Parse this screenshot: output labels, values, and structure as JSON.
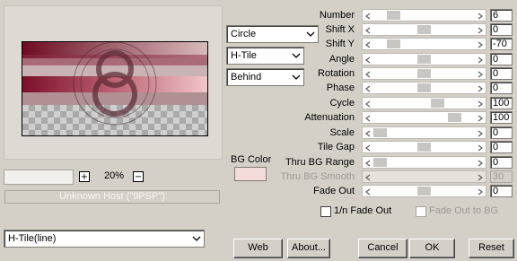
{
  "preview": {
    "zoom_minus": "−",
    "zoom_plus": "+",
    "zoom_value": "20%",
    "host_status": "Unknown Host (\"9PSP\")"
  },
  "dropdowns": {
    "shape": {
      "value": "Circle"
    },
    "tile": {
      "value": "H-Tile"
    },
    "placement": {
      "value": "Behind"
    },
    "preset": {
      "value": "H-Tile(line)"
    }
  },
  "bg_color": {
    "label": "BG Color",
    "swatch": "#f4ddd8"
  },
  "params": [
    {
      "label": "Number",
      "value": "6",
      "level": 0.15
    },
    {
      "label": "Shift X",
      "value": "0",
      "level": 0.5
    },
    {
      "label": "Shift Y",
      "value": "-70",
      "level": 0.15
    },
    {
      "label": "Angle",
      "value": "0",
      "level": 0.5
    },
    {
      "label": "Rotation",
      "value": "0",
      "level": 0.5
    },
    {
      "label": "Phase",
      "value": "0",
      "level": 0.5
    },
    {
      "label": "Cycle",
      "value": "100",
      "level": 0.65
    },
    {
      "label": "Attenuation",
      "value": "100",
      "level": 0.85
    },
    {
      "label": "Scale",
      "value": "0",
      "level": 0.0
    },
    {
      "label": "Tile Gap",
      "value": "0",
      "level": 0.5
    },
    {
      "label": "Thru BG Range",
      "value": "0",
      "level": 0.0
    },
    {
      "label": "Thru BG Smooth",
      "value": "30",
      "level": null,
      "disabled": true
    },
    {
      "label": "Fade Out",
      "value": "0",
      "level": 0.5
    }
  ],
  "checkboxes": {
    "fade_out_1n": "1/n Fade Out",
    "fade_out_bg": "Fade Out to BG"
  },
  "buttons": {
    "web": "Web",
    "about": "About...",
    "cancel": "Cancel",
    "ok": "OK",
    "reset": "Reset"
  }
}
